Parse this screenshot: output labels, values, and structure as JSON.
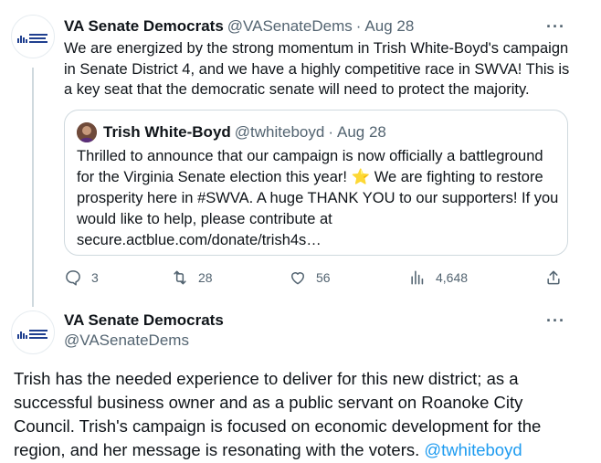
{
  "tweet1": {
    "display_name": "VA Senate Democrats",
    "handle": "@VASenateDems",
    "separator": "·",
    "date": "Aug 28",
    "text": "We are energized by the strong momentum in Trish White-Boyd's campaign in Senate District 4, and we have a highly competitive race in SWVA! This is a key seat that the democratic senate will need to protect the majority.",
    "more_label": "···",
    "quote": {
      "display_name": "Trish White-Boyd",
      "handle": "@twhiteboyd",
      "separator": "·",
      "date": "Aug 28",
      "text_before_star": "Thrilled to announce that our campaign is now officially a battleground for the Virginia Senate election this year!",
      "star": "⭐",
      "text_after_star": "We are fighting to restore prosperity here in #SWVA. A huge THANK YOU to our supporters! If you would like to help, please contribute at secure.actblue.com/donate/trish4s…"
    },
    "actions": {
      "replies": "3",
      "retweets": "28",
      "likes": "56",
      "views": "4,648"
    }
  },
  "tweet2": {
    "display_name": "VA Senate Democrats",
    "handle": "@VASenateDems",
    "more_label": "···",
    "text": "Trish has the needed experience to deliver for this new district; as a successful business owner and as a public servant on Roanoke City Council. Trish's campaign is focused on economic development for the region, and her message is resonating with the voters.",
    "mention": "@twhiteboyd"
  },
  "colors": {
    "accent": "#1d9bf0",
    "muted": "#536471",
    "border": "#cfd9de",
    "star": "#f5b400"
  }
}
